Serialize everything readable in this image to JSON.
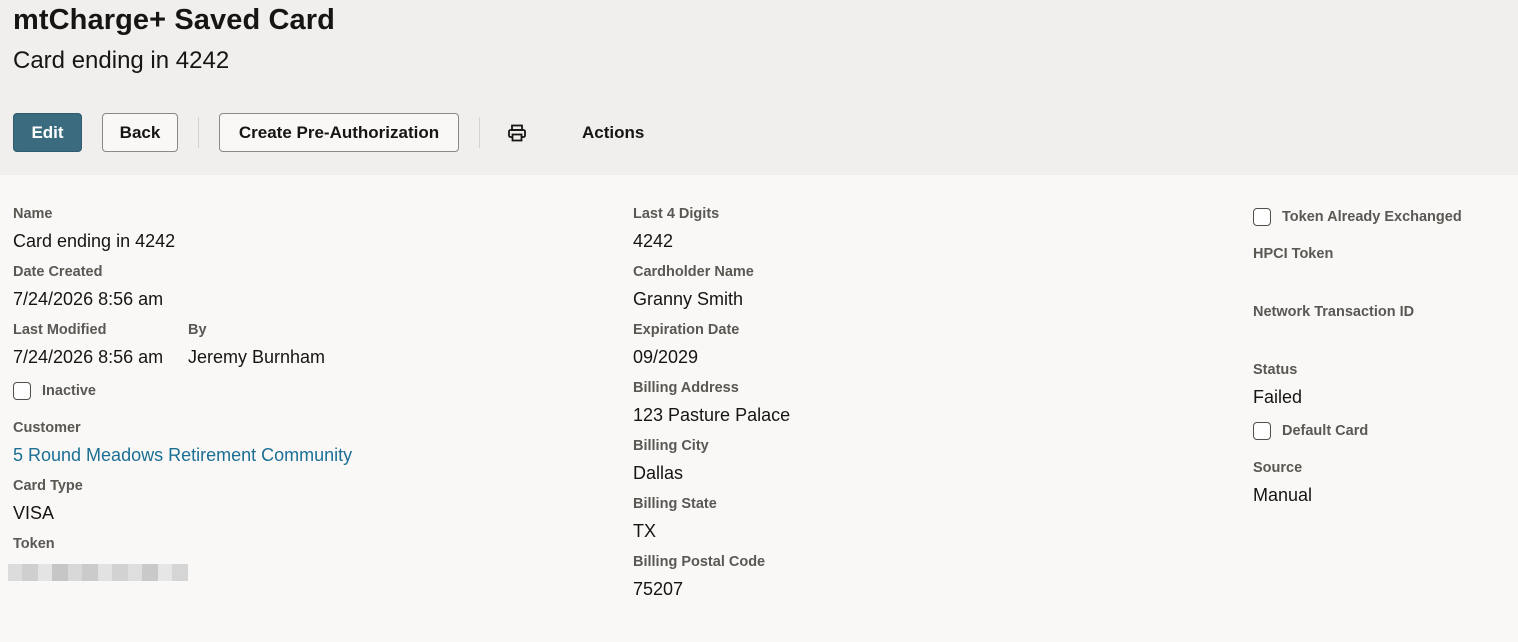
{
  "page": {
    "title": "mtCharge+ Saved Card",
    "subtitle": "Card ending in 4242"
  },
  "toolbar": {
    "edit_label": "Edit",
    "back_label": "Back",
    "preauth_label": "Create Pre-Authorization",
    "print_icon": "print-icon",
    "actions_label": "Actions"
  },
  "colors": {
    "primary_button": "#3a6b7e",
    "header_bg": "#f1efed",
    "body_bg": "#f9f8f6",
    "link": "#1b6f94"
  },
  "column1": {
    "name_label": "Name",
    "name_value": "Card ending in 4242",
    "date_created_label": "Date Created",
    "date_created_value": "7/24/2026 8:56 am",
    "last_modified_label": "Last Modified",
    "last_modified_value": "7/24/2026 8:56 am",
    "by_label": "By",
    "by_value": "Jeremy Burnham",
    "inactive_label": "Inactive",
    "inactive_checked": false,
    "customer_label": "Customer",
    "customer_value": "5 Round Meadows Retirement Community",
    "card_type_label": "Card Type",
    "card_type_value": "VISA",
    "token_label": "Token"
  },
  "column2": {
    "last4_label": "Last 4 Digits",
    "last4_value": "4242",
    "cardholder_label": "Cardholder Name",
    "cardholder_value": "Granny Smith",
    "expiration_label": "Expiration Date",
    "expiration_value": "09/2029",
    "billing_address_label": "Billing Address",
    "billing_address_value": "123 Pasture Palace",
    "billing_city_label": "Billing City",
    "billing_city_value": "Dallas",
    "billing_state_label": "Billing State",
    "billing_state_value": "TX",
    "billing_postal_label": "Billing Postal Code",
    "billing_postal_value": "75207"
  },
  "column3": {
    "token_exchanged_label": "Token Already Exchanged",
    "token_exchanged_checked": false,
    "hpci_token_label": "HPCI Token",
    "network_txn_label": "Network Transaction ID",
    "status_label": "Status",
    "status_value": "Failed",
    "default_card_label": "Default Card",
    "default_card_checked": false,
    "source_label": "Source",
    "source_value": "Manual"
  }
}
